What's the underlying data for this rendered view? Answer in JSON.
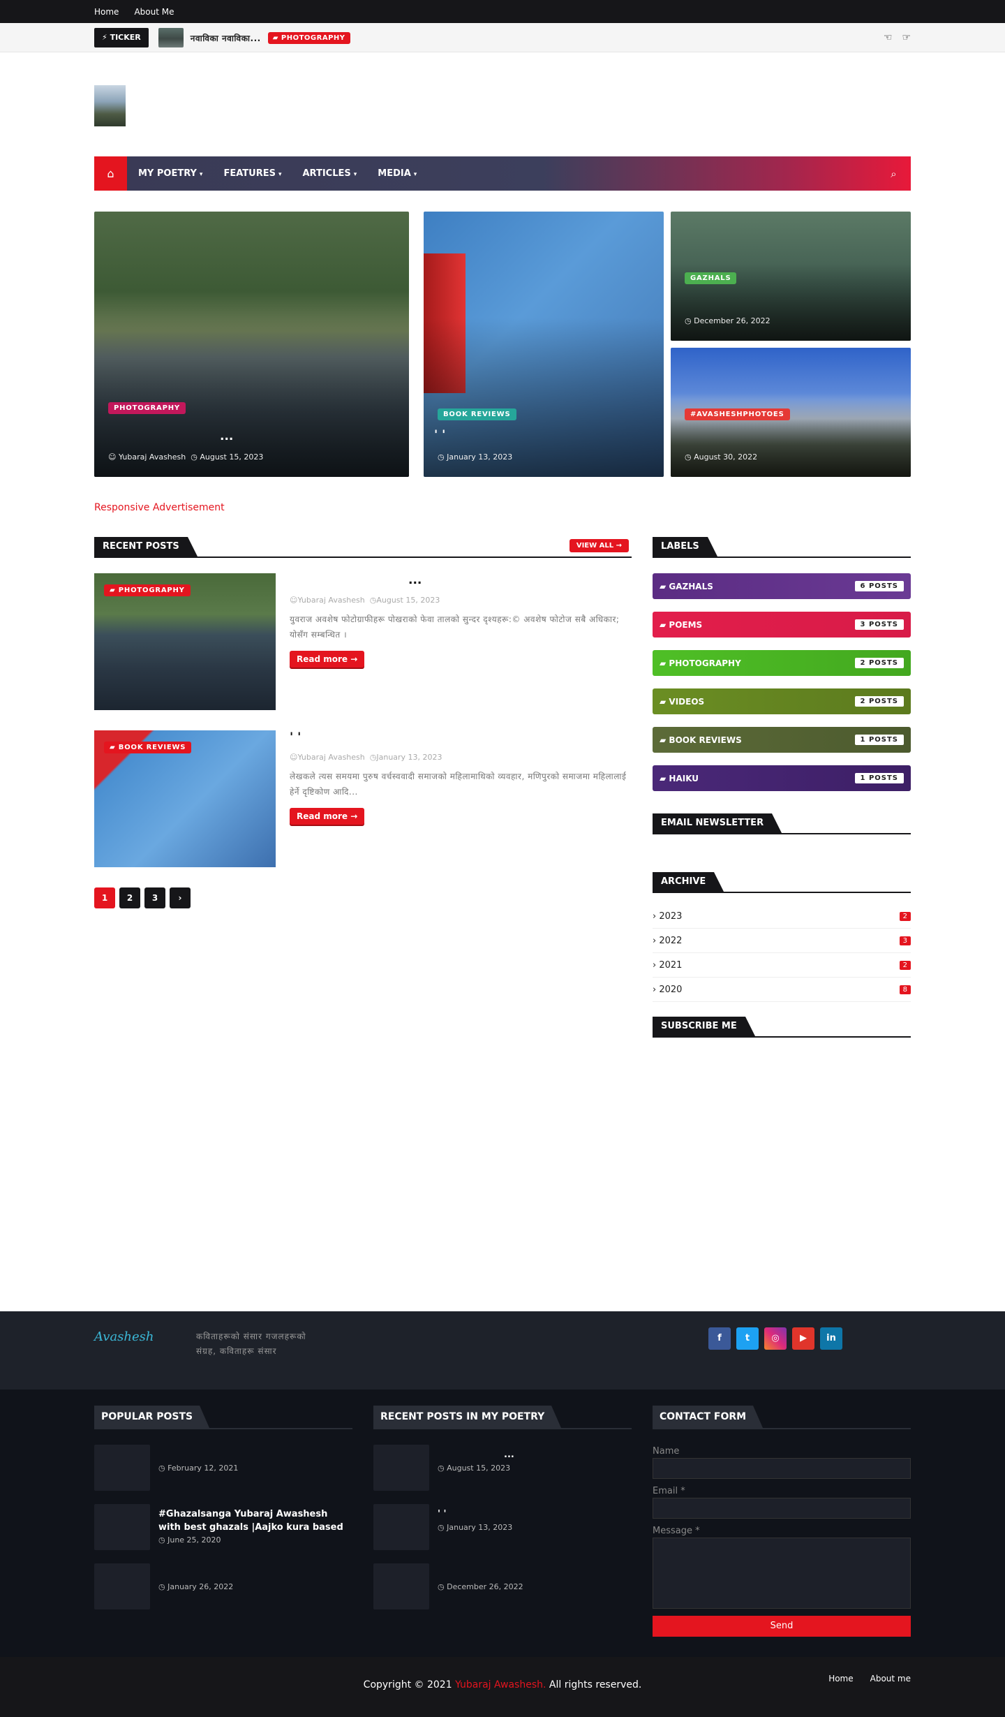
{
  "topbar": {
    "links": [
      "Home",
      "About Me"
    ]
  },
  "ticker": {
    "label": "TICKER",
    "title": "नवाविका नवाविका...",
    "badge": "PHOTOGRAPHY"
  },
  "nav": {
    "items": [
      "MY POETRY",
      "FEATURES",
      "ARTICLES",
      "MEDIA"
    ]
  },
  "featured": [
    {
      "label": "PHOTOGRAPHY",
      "label_color": "#c2185b",
      "title": "...",
      "author": "Yubaraj Avashesh",
      "date": "August 15, 2023"
    },
    {
      "label": "BOOK REVIEWS",
      "label_color": "#26a69a",
      "title": "'                   '",
      "date": "January 13, 2023"
    },
    {
      "label": "GAZHALS",
      "label_color": "#4caf50",
      "date": "December 26, 2022"
    },
    {
      "label": "#AVASHESHPHOTOES",
      "label_color": "#e53935",
      "date": "August 30, 2022"
    }
  ],
  "ad": {
    "text": "Responsive Advertisement"
  },
  "recent": {
    "heading": "RECENT POSTS",
    "view_all": "VIEW ALL",
    "posts": [
      {
        "tag": "PHOTOGRAPHY",
        "title": "...",
        "author": "Yubaraj Avashesh",
        "date": "August 15, 2023",
        "excerpt": "युवराज अवशेष फोटोग्राफीहरू पोखराको फेवा तालको सुन्दर दृश्यहरू:© अवशेष फोटोज सबै अधिकार; योसँग सम्बन्धित ।",
        "more": "Read more"
      },
      {
        "tag": "BOOK REVIEWS",
        "title": "'                              '",
        "author": "Yubaraj Avashesh",
        "date": "January 13, 2023",
        "excerpt": "लेखकले त्यस समयमा पुरुष वर्चस्ववादी समाजको महिलामाथिको व्यवहार, मणिपुरको समाजमा महिलालाई हेर्ने दृष्टिकोण आदि...",
        "more": "Read more"
      }
    ],
    "pages": [
      "1",
      "2",
      "3",
      "›"
    ]
  },
  "sidebar": {
    "labels_heading": "LABELS",
    "labels": [
      {
        "name": "GAZHALS",
        "count": "6 POSTS",
        "color": "#5b2c83"
      },
      {
        "name": "POEMS",
        "count": "3 POSTS",
        "color": "#e21e4b"
      },
      {
        "name": "PHOTOGRAPHY",
        "count": "2 POSTS",
        "color": "#4fbf26"
      },
      {
        "name": "VIDEOS",
        "count": "2 POSTS",
        "color": "#6b8e23"
      },
      {
        "name": "BOOK REVIEWS",
        "count": "1 POSTS",
        "color": "#5c6b38"
      },
      {
        "name": "HAIKU",
        "count": "1 POSTS",
        "color": "#4a2878"
      }
    ],
    "newsletter_heading": "EMAIL NEWSLETTER",
    "archive_heading": "ARCHIVE",
    "archive": [
      {
        "year": "2023",
        "count": "2"
      },
      {
        "year": "2022",
        "count": "3"
      },
      {
        "year": "2021",
        "count": "2"
      },
      {
        "year": "2020",
        "count": "8"
      }
    ],
    "subscribe_heading": "SUBSCRIBE ME"
  },
  "footer": {
    "logo_text": "Avashesh",
    "description": "कविताहरूको संसार गजलहरूको संग्रह, कविताहरू संसार",
    "socials": [
      {
        "icon": "facebook-icon",
        "glyph": "f",
        "color": "#3b5998"
      },
      {
        "icon": "twitter-icon",
        "glyph": "t",
        "color": "#1da1f2"
      },
      {
        "icon": "instagram-icon",
        "glyph": "◎",
        "color": "#c13584"
      },
      {
        "icon": "youtube-icon",
        "glyph": "▶",
        "color": "#e0352b"
      },
      {
        "icon": "linkedin-icon",
        "glyph": "in",
        "color": "#0e76a8"
      }
    ],
    "popular_heading": "POPULAR POSTS",
    "popular": [
      {
        "title": "",
        "date": "February 12, 2021"
      },
      {
        "title": "#Ghazalsanga Yubaraj Awashesh with best ghazals |Aajko kura based on Nep...",
        "date": "June 25, 2020"
      },
      {
        "title": "",
        "date": "January 26, 2022"
      }
    ],
    "recent_poetry_heading": "RECENT POSTS IN MY POETRY",
    "recent_poetry": [
      {
        "title": "...",
        "date": "August 15, 2023"
      },
      {
        "title": "'                   '",
        "date": "January 13, 2023"
      },
      {
        "title": "",
        "date": "December 26, 2022"
      }
    ],
    "contact_heading": "CONTACT FORM",
    "contact": {
      "name_label": "Name",
      "email_label": "Email *",
      "message_label": "Message *",
      "send": "Send"
    },
    "copyright_prefix": "Copyright © 2021 ",
    "copyright_brand": "Yubaraj Awashesh.",
    "copyright_suffix": " All rights reserved.",
    "menu": [
      "Home",
      "About me"
    ]
  }
}
